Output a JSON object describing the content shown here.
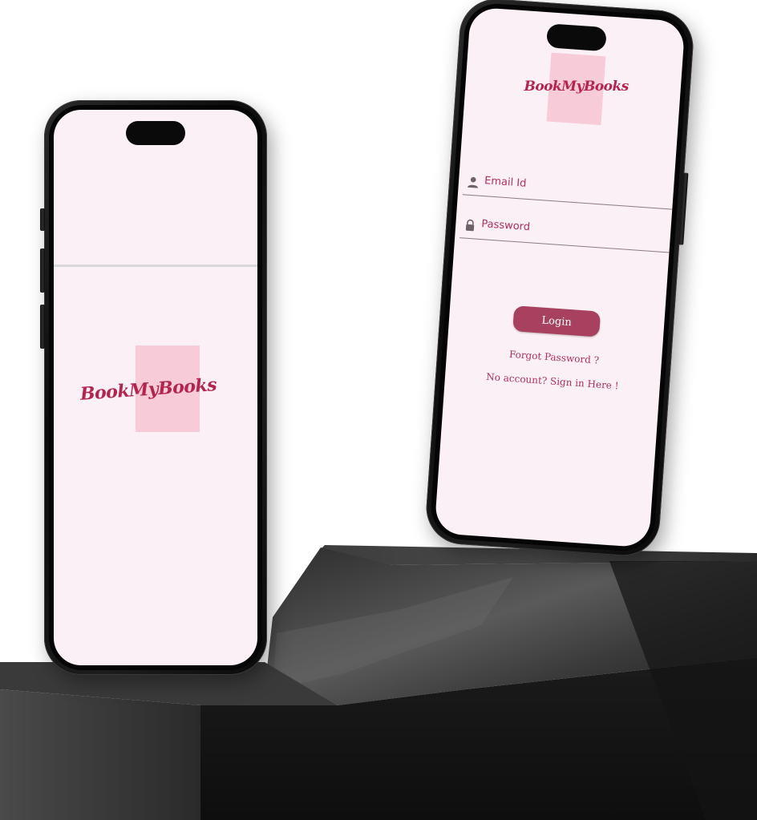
{
  "splash_screen": {
    "logo_text": "BookMyBooks"
  },
  "login_screen": {
    "logo_text": "BookMyBooks",
    "email_field": {
      "placeholder": "Email Id",
      "icon": "person-icon"
    },
    "password_field": {
      "placeholder": "Password",
      "icon": "lock-icon"
    },
    "login_button_label": "Login",
    "forgot_password_link": "Forgot Password ?",
    "signup_link": "No account? Sign in Here !"
  },
  "colors": {
    "screen_background": "#fbf0f5",
    "logo_card": "#f7cbd8",
    "brand_text": "#b3244f",
    "login_button": "#a8405f"
  }
}
